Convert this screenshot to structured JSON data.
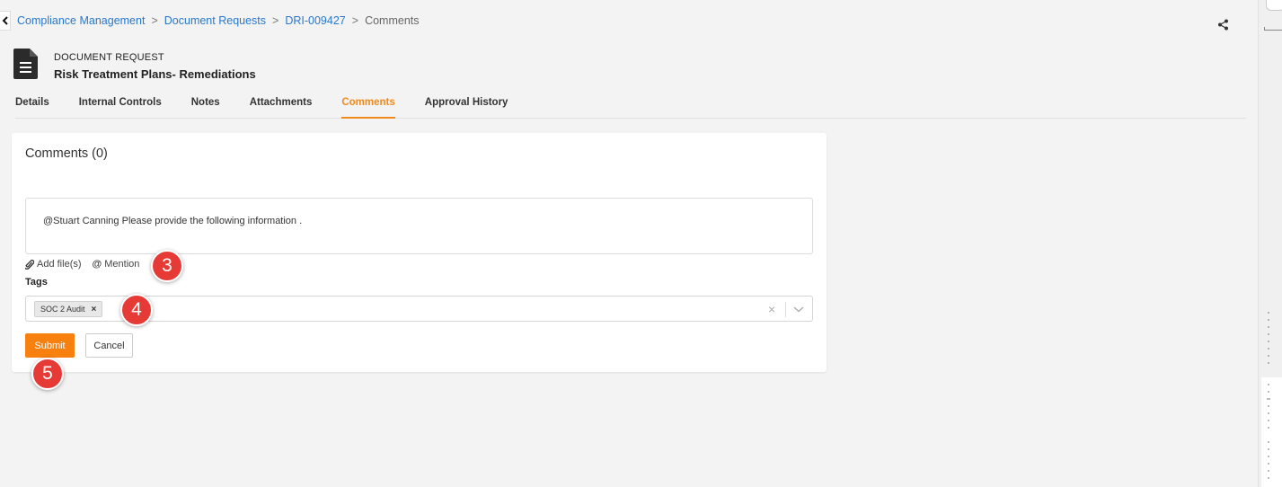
{
  "breadcrumb": {
    "items": [
      "Compliance Management",
      "Document Requests",
      "DRI-009427"
    ],
    "separator": ">",
    "current": "Comments"
  },
  "document": {
    "type_label": "DOCUMENT REQUEST",
    "title": "Risk Treatment Plans- Remediations"
  },
  "tabs": [
    {
      "label": "Details",
      "active": false
    },
    {
      "label": "Internal Controls",
      "active": false
    },
    {
      "label": "Notes",
      "active": false
    },
    {
      "label": "Attachments",
      "active": false
    },
    {
      "label": "Comments",
      "active": true
    },
    {
      "label": "Approval History",
      "active": false
    }
  ],
  "comments": {
    "heading": "Comments (0)",
    "draft_text": "@Stuart Canning Please provide the following information .",
    "add_files_label": "Add file(s)",
    "mention_symbol": "@",
    "mention_label": "Mention",
    "tags_label": "Tags",
    "tags": [
      "SOC 2 Audit"
    ],
    "tag_remove_glyph": "×",
    "clear_glyph": "×",
    "submit_label": "Submit",
    "cancel_label": "Cancel"
  },
  "annotations": {
    "step_3": "3",
    "step_4": "4",
    "step_5": "5"
  },
  "colors": {
    "accent": "#f08a1c",
    "submit": "#f7800f",
    "link": "#2a78c9",
    "badge": "#e63a36"
  },
  "icons": [
    "back-arrow-icon",
    "share-icon",
    "document-icon",
    "paperclip-icon",
    "chevron-down-icon"
  ]
}
